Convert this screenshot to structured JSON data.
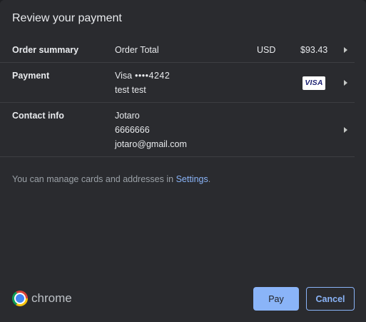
{
  "dialog": {
    "title": "Review your payment"
  },
  "order_summary": {
    "label": "Order summary",
    "description": "Order Total",
    "currency": "USD",
    "amount": "$93.43"
  },
  "payment": {
    "label": "Payment",
    "card_brand": "Visa",
    "card_number": "••••4242",
    "cardholder": "test test",
    "card_logo_text": "VISA"
  },
  "contact_info": {
    "label": "Contact info",
    "name": "Jotaro",
    "phone": "6666666",
    "email": "jotaro@gmail.com"
  },
  "note": {
    "text": "You can manage cards and addresses in ",
    "link_label": "Settings",
    "suffix": "."
  },
  "footer": {
    "brand_name": "chrome",
    "pay_label": "Pay",
    "cancel_label": "Cancel"
  }
}
